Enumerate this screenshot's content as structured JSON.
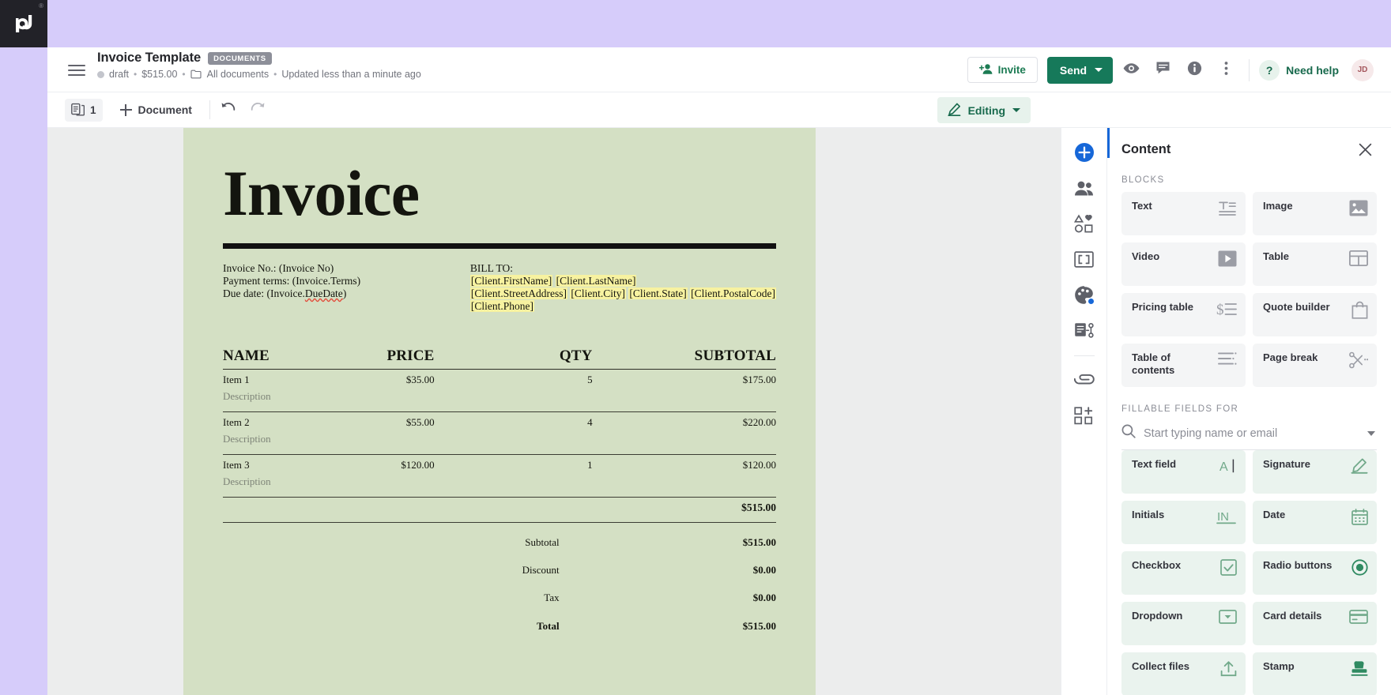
{
  "brand": {
    "logo_text": "pd",
    "registered_mark": "®"
  },
  "header": {
    "doc_title": "Invoice Template",
    "doc_type_badge": "DOCUMENTS",
    "status": "draft",
    "amount": "$515.00",
    "folder": "All documents",
    "updated": "Updated less than a minute ago",
    "sep": "•",
    "invite_label": "Invite",
    "send_label": "Send",
    "need_help_label": "Need help",
    "help_glyph": "?",
    "avatar_initials": "JD"
  },
  "toolbar": {
    "page_count": "1",
    "add_document_label": "Document",
    "editing_label": "Editing"
  },
  "invoice": {
    "title": "Invoice",
    "invoice_no_line": "Invoice No.: (Invoice No)",
    "payment_terms_line": "Payment terms: (Invoice.Terms)",
    "due_date_prefix": "Due date: (Invoice.",
    "due_date_spell": "DueDate",
    "due_date_suffix": ")",
    "bill_to_label": "BILL TO:",
    "bill_to_fields": [
      [
        "[Client.FirstName]",
        "[Client.LastName]"
      ],
      [
        "[Client.StreetAddress]",
        "[Client.City]",
        "[Client.State]",
        "[Client.PostalCode]"
      ],
      [
        "[Client.Phone]"
      ]
    ],
    "columns": [
      "NAME",
      "PRICE",
      "QTY",
      "SUBTOTAL"
    ],
    "items": [
      {
        "name": "Item 1",
        "description": "Description",
        "price": "$35.00",
        "qty": "5",
        "subtotal": "$175.00"
      },
      {
        "name": "Item 2",
        "description": "Description",
        "price": "$55.00",
        "qty": "4",
        "subtotal": "$220.00"
      },
      {
        "name": "Item 3",
        "description": "Description",
        "price": "$120.00",
        "qty": "1",
        "subtotal": "$120.00"
      }
    ],
    "items_total": "$515.00",
    "totals": [
      {
        "label": "Subtotal",
        "value": "$515.00"
      },
      {
        "label": "Discount",
        "value": "$0.00"
      },
      {
        "label": "Tax",
        "value": "$0.00"
      },
      {
        "label": "Total",
        "value": "$515.00"
      }
    ],
    "page_bg_color": "#d4e0c4",
    "highlight_color": "#f7f2a0"
  },
  "icon_rail": [
    {
      "name": "add-content-icon"
    },
    {
      "name": "recipients-icon"
    },
    {
      "name": "shapes-icon"
    },
    {
      "name": "variables-icon"
    },
    {
      "name": "theme-palette-icon",
      "badge": true
    },
    {
      "name": "workflow-icon"
    },
    {
      "name": "attachments-icon"
    },
    {
      "name": "apps-icon"
    }
  ],
  "panel": {
    "title": "Content",
    "blocks_label": "BLOCKS",
    "blocks": [
      {
        "label": "Text",
        "icon": "text-block-icon"
      },
      {
        "label": "Image",
        "icon": "image-block-icon"
      },
      {
        "label": "Video",
        "icon": "video-block-icon"
      },
      {
        "label": "Table",
        "icon": "table-block-icon"
      },
      {
        "label": "Pricing table",
        "icon": "pricing-table-icon"
      },
      {
        "label": "Quote builder",
        "icon": "quote-builder-icon"
      },
      {
        "label": "Table of contents",
        "icon": "table-of-contents-icon"
      },
      {
        "label": "Page break",
        "icon": "page-break-icon"
      }
    ],
    "fillable_label": "FILLABLE FIELDS FOR",
    "search_placeholder": "Start typing name or email",
    "search_value": "",
    "fields": [
      {
        "label": "Text field",
        "icon": "text-field-icon"
      },
      {
        "label": "Signature",
        "icon": "signature-icon"
      },
      {
        "label": "Initials",
        "icon": "initials-icon"
      },
      {
        "label": "Date",
        "icon": "date-icon"
      },
      {
        "label": "Checkbox",
        "icon": "checkbox-icon"
      },
      {
        "label": "Radio buttons",
        "icon": "radio-buttons-icon"
      },
      {
        "label": "Dropdown",
        "icon": "dropdown-icon"
      },
      {
        "label": "Card details",
        "icon": "card-details-icon"
      },
      {
        "label": "Collect files",
        "icon": "collect-files-icon"
      },
      {
        "label": "Stamp",
        "icon": "stamp-icon"
      }
    ],
    "accent_color": "#1667d8",
    "field_tile_color": "#eaf3ee",
    "block_tile_color": "#f4f5f6"
  }
}
